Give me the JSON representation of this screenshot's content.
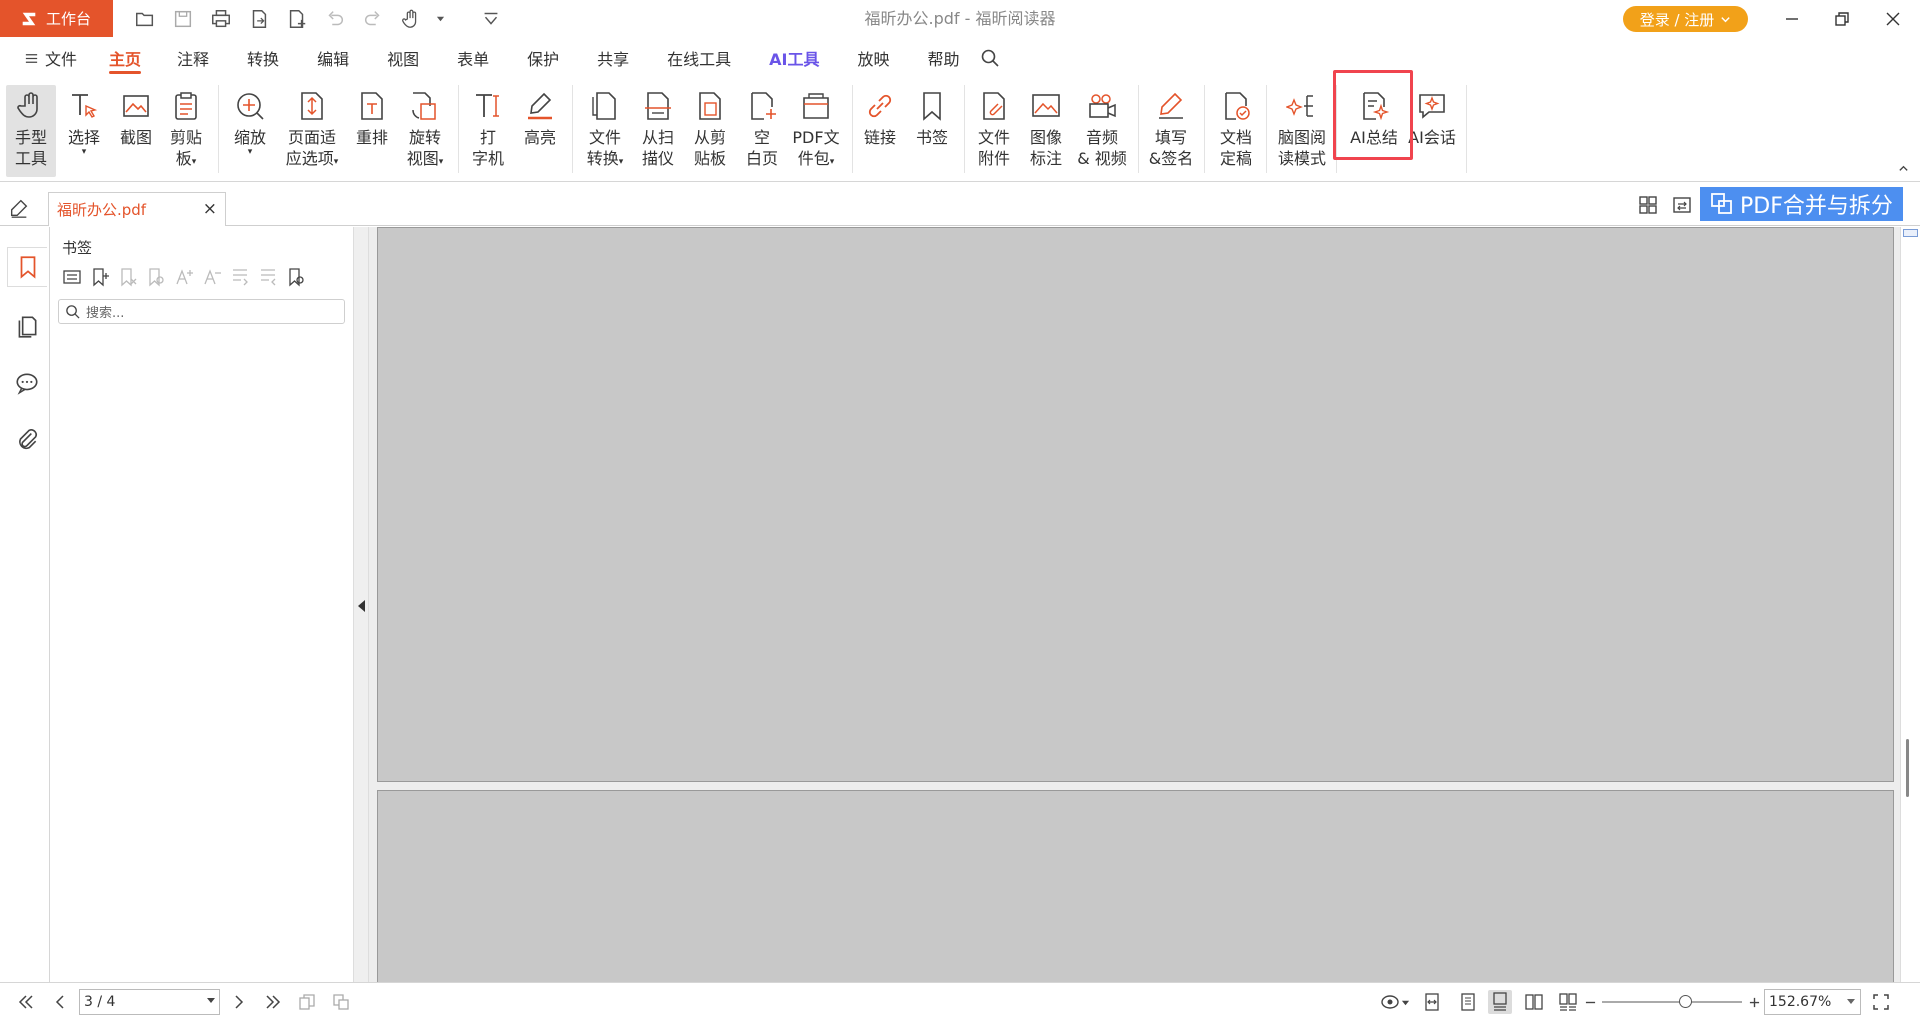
{
  "titlebar": {
    "workspace_label": "工作台",
    "window_title": "福昕办公.pdf - 福昕阅读器",
    "login_label": "登录 / 注册",
    "accent": "#e4542b",
    "login_color": "#f2a119"
  },
  "menu": {
    "file_label": "文件",
    "items": [
      "主页",
      "注释",
      "转换",
      "编辑",
      "视图",
      "表单",
      "保护",
      "共享",
      "在线工具",
      "AI工具",
      "放映",
      "帮助"
    ],
    "active": "主页"
  },
  "ribbon": {
    "hand": [
      "手型",
      "工具"
    ],
    "select": "选择",
    "screenshot": "截图",
    "clipboard": [
      "剪贴",
      "板"
    ],
    "zoom": "缩放",
    "fit_page": [
      "页面适",
      "应选项"
    ],
    "reflow": "重排",
    "rotate": [
      "旋转",
      "视图"
    ],
    "typewriter": [
      "打",
      "字机"
    ],
    "highlight": "高亮",
    "convert_file": [
      "文件",
      "转换"
    ],
    "from_scanner": [
      "从扫",
      "描仪"
    ],
    "from_clipboard": [
      "从剪",
      "贴板"
    ],
    "blank_page": [
      "空",
      "白页"
    ],
    "pdf_package": [
      "PDF文",
      "件包"
    ],
    "link": "链接",
    "bookmark": "书签",
    "file_attachment": [
      "文件",
      "附件"
    ],
    "image_annotation": [
      "图像",
      "标注"
    ],
    "audio_video": [
      "音频",
      "& 视频"
    ],
    "fill_sign": [
      "填写",
      "&签名"
    ],
    "finalize": [
      "文档",
      "定稿"
    ],
    "mindmap": [
      "脑图阅",
      "读模式"
    ],
    "ai_summary": "AI总结",
    "ai_chat": "AI会话"
  },
  "tabs": {
    "doc_tab": "福昕办公.pdf",
    "merge_button": "PDF合并与拆分",
    "merge_color": "#4d8ff0"
  },
  "bookmark_panel": {
    "title": "书签",
    "search_placeholder": "搜索..."
  },
  "status": {
    "page_value": "3 / 4",
    "zoom_value": "152.67%"
  },
  "icons": [
    "logo-icon",
    "open-folder-icon",
    "save-icon",
    "print-icon",
    "export-icon",
    "new-page-icon",
    "undo-icon",
    "redo-icon",
    "hand-icon",
    "customize-icon",
    "minimize-icon",
    "restore-icon",
    "close-icon",
    "search-icon",
    "bookmark-icon",
    "pages-icon",
    "comment-icon",
    "attachment-icon"
  ]
}
